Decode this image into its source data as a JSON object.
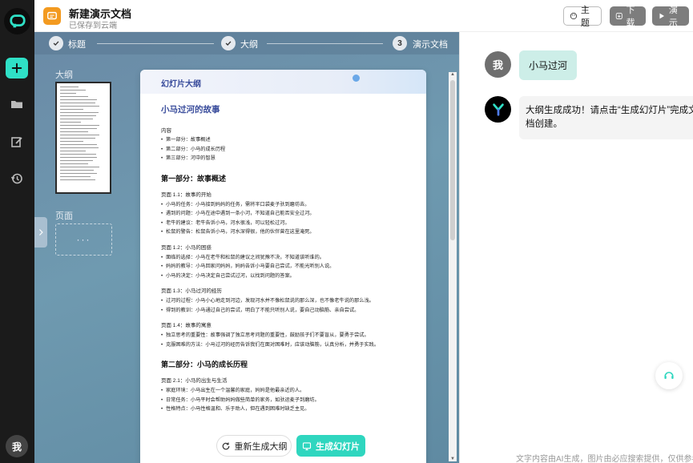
{
  "rail": {
    "avatar_text": "我"
  },
  "header": {
    "title": "新建演示文档",
    "subtitle": "已保存到云端",
    "theme_label": "主题",
    "download_label": "下载",
    "present_label": "演示"
  },
  "steps": [
    {
      "label": "标题"
    },
    {
      "label": "大纲"
    },
    {
      "number": "3",
      "label": "演示文档"
    }
  ],
  "sidebar": {
    "outline_label": "大纲",
    "page_label": "页面",
    "page_slot": "···"
  },
  "document": {
    "header": "幻灯片大纲",
    "title": "小马过河的故事",
    "toc_label": "内容",
    "toc": [
      "第一部分：故事概述",
      "第二部分：小马的成长历程",
      "第三部分：河中的智慧"
    ],
    "part1_title": "第一部分：故事概述",
    "p11_title": "页面 1.1：故事的开始",
    "p11": [
      "小马的任务：小马接到妈妈的任务，需将半口袋麦子驮到磨坊去。",
      "遇到的问题：小马在途中遇到一条小河，不知道自己能否安全过河。",
      "老牛的建议：老牛告诉小马，河水很浅，可以轻松过河。",
      "松鼠的警告：松鼠告诉小马，河水深得很，他的伙伴曾在这里淹死。"
    ],
    "p12_title": "页面 1.2：小马的困惑",
    "p12": [
      "面临的选择：小马在老牛和松鼠的建议之间犹豫不决，不知道该听谁的。",
      "妈妈的教导：小马回家问妈妈，妈妈告诉小马要自己尝试，不能光听别人说。",
      "小马的决定：小马决定自己尝试过河，以找到问题的答案。"
    ],
    "p13_title": "页面 1.3：小马过河的经历",
    "p13": [
      "过河的过程：小马小心地走到河边，发现河水并不像松鼠说的那么深，也不像老牛说的那么浅。",
      "得到的教训：小马通过自己的尝试，明白了不能只听别人说，要自己动脑筋、亲自尝试。"
    ],
    "p14_title": "页面 1.4：故事的寓意",
    "p14": [
      "独立思考的重要性：故事强调了独立思考问题的重要性，鼓励孩子们不要盲从，要勇于尝试。",
      "克服困难的方法：小马过河的经历告诉我们在面对困难时，应该动脑筋，认真分析，并勇于实践。"
    ],
    "part2_title": "第二部分：小马的成长历程",
    "p21_title": "页面 2.1：小马的出生与生活",
    "p21": [
      "家庭环境：小马出生在一个温馨的家庭，妈妈是他最亲近的人。",
      "日常任务：小马平时会帮助妈妈做些简单的家务，如驮运麦子到磨坊。",
      "性格特点：小马性格温和、乐于助人，但在遇到困难时缺乏主见。"
    ]
  },
  "actions": {
    "regenerate_label": "重新生成大纲",
    "generate_label": "生成幻灯片"
  },
  "chat": {
    "user_avatar": "我",
    "user_message": "小马过河",
    "bot_message": "大纲生成成功！请点击“生成幻灯片”完成文档创建。",
    "footer": "文字内容由AI生成，图片由必应搜索提供，仅供参考"
  },
  "colors": {
    "accent": "#2fd6bf",
    "rail_bg": "#1b1b1b",
    "doc_heading": "#3a4d9c",
    "brand_orange": "#f39a20"
  }
}
